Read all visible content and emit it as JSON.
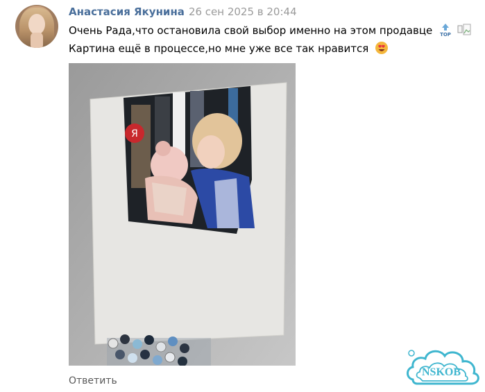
{
  "comment": {
    "author": "Анастасия Якунина",
    "date": "26 сен 2025 в 20:44",
    "text_line1": "Очень Рада,что остановила свой выбор именно на этом продавце",
    "text_line2": "Картина ещё в процессе,но мне уже все так нравится",
    "icons": [
      "top-badge-icon",
      "broken-image-icon",
      "heart-eyes-emoji-icon"
    ],
    "photo": "canvas-painting-photo",
    "reply_label": "Ответить"
  },
  "watermark": {
    "text": "NSKOB",
    "color": "#3fb6cf"
  },
  "colors": {
    "author": "#4a6f9b",
    "date": "#9a9a9a",
    "reply": "#585858"
  }
}
